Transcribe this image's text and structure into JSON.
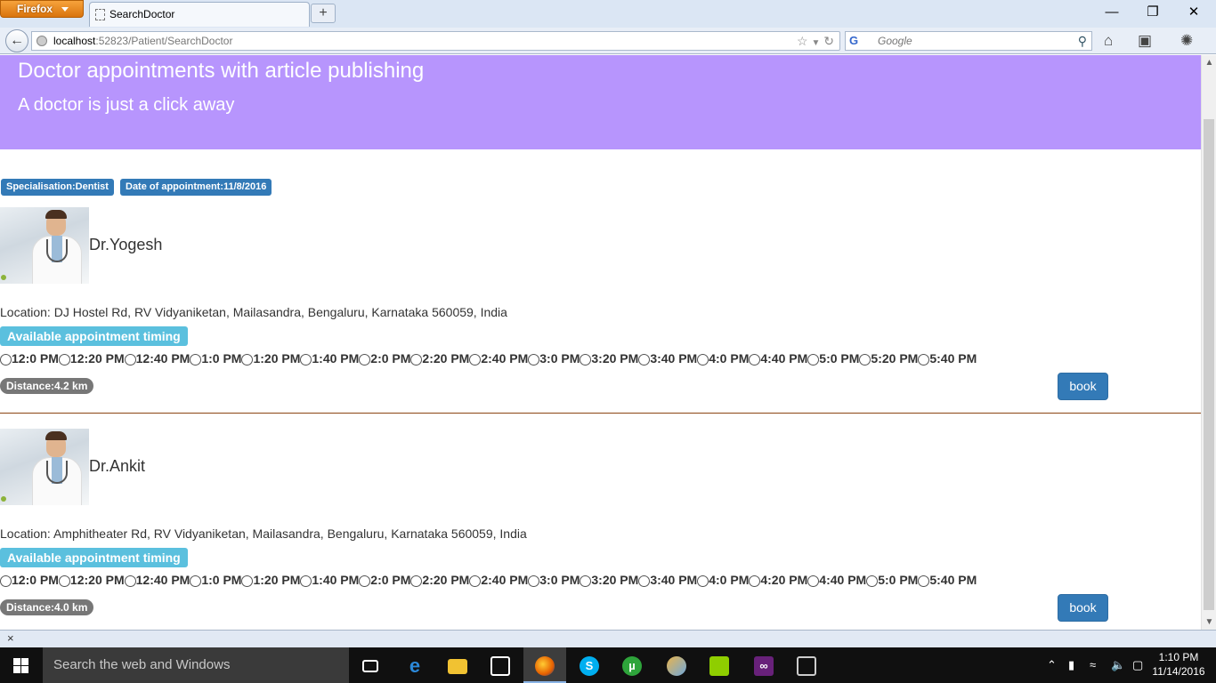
{
  "browser": {
    "app_button": "Firefox",
    "tab_title": "SearchDoctor",
    "new_tab": "+",
    "url_host": "localhost",
    "url_path": ":52823/Patient/SearchDoctor",
    "search_placeholder": "Google",
    "window_controls": {
      "minimize": "—",
      "restore": "❐",
      "close": "✕"
    }
  },
  "page": {
    "header_title": "Doctor appointments with article publishing",
    "header_subtitle": "A doctor is just a click away",
    "specialisation_label": "Specialisation:Dentist",
    "date_label": "Date of appointment:11/8/2016",
    "timing_label": "Available appointment timing",
    "book_label": "book",
    "doctors": [
      {
        "name": "Dr.Yogesh",
        "location": "Location: DJ Hostel Rd, RV Vidyaniketan, Mailasandra, Bengaluru, Karnataka 560059, India",
        "slots": [
          "12:0 PM",
          "12:20 PM",
          "12:40 PM",
          "1:0 PM",
          "1:20 PM",
          "1:40 PM",
          "2:0 PM",
          "2:20 PM",
          "2:40 PM",
          "3:0 PM",
          "3:20 PM",
          "3:40 PM",
          "4:0 PM",
          "4:40 PM",
          "5:0 PM",
          "5:20 PM",
          "5:40 PM"
        ],
        "distance": "Distance:4.2 km"
      },
      {
        "name": "Dr.Ankit",
        "location": "Location: Amphitheater Rd, RV Vidyaniketan, Mailasandra, Bengaluru, Karnataka 560059, India",
        "slots": [
          "12:0 PM",
          "12:20 PM",
          "12:40 PM",
          "1:0 PM",
          "1:20 PM",
          "1:40 PM",
          "2:0 PM",
          "2:20 PM",
          "2:40 PM",
          "3:0 PM",
          "3:20 PM",
          "3:40 PM",
          "4:0 PM",
          "4:20 PM",
          "4:40 PM",
          "5:0 PM",
          "5:40 PM"
        ],
        "distance": "Distance:4.0 km"
      }
    ]
  },
  "findbar": {
    "close": "×"
  },
  "taskbar": {
    "search_placeholder": "Search the web and Windows",
    "time": "1:10 PM",
    "date": "11/14/2016",
    "apps": [
      "task-view-icon",
      "edge-icon",
      "file-explorer-icon",
      "store-icon",
      "firefox-icon",
      "skype-icon",
      "utorrent-icon",
      "paint-icon",
      "notepad-plus-icon",
      "visual-studio-icon",
      "tools-icon"
    ]
  }
}
